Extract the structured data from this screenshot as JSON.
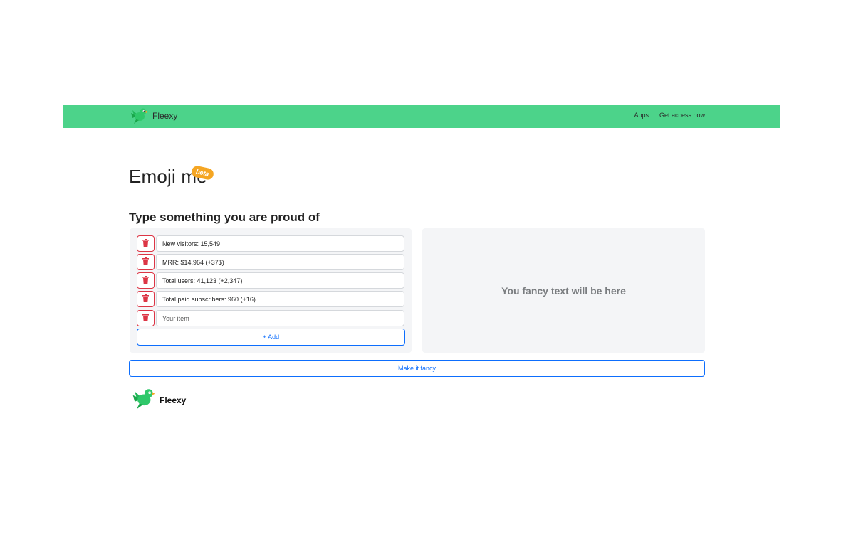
{
  "navbar": {
    "brand": "Fleexy",
    "links": [
      "Apps",
      "Get access now"
    ],
    "background": "#4cd38a"
  },
  "header": {
    "title": "Emoji me",
    "badge": "beta",
    "subtitle": "Type something you are proud of"
  },
  "items": [
    {
      "value": "New visitors: 15,549",
      "placeholder": ""
    },
    {
      "value": "MRR: $14,964 (+37$)",
      "placeholder": ""
    },
    {
      "value": "Total users: 41,123 (+2,347)",
      "placeholder": ""
    },
    {
      "value": "Total paid subscribers: 960 (+16)",
      "placeholder": ""
    },
    {
      "value": "",
      "placeholder": "Your item"
    }
  ],
  "add_label": "+ Add",
  "output": {
    "placeholder": "You fancy text will be here"
  },
  "make_fancy_label": "Make it fancy",
  "footer": {
    "brand": "Fleexy"
  },
  "icons": {
    "logo": "parrot-logo-icon",
    "delete": "trash-icon"
  },
  "colors": {
    "accent": "#0d6efd",
    "danger": "#dc3545",
    "badge": "#f5a623"
  }
}
